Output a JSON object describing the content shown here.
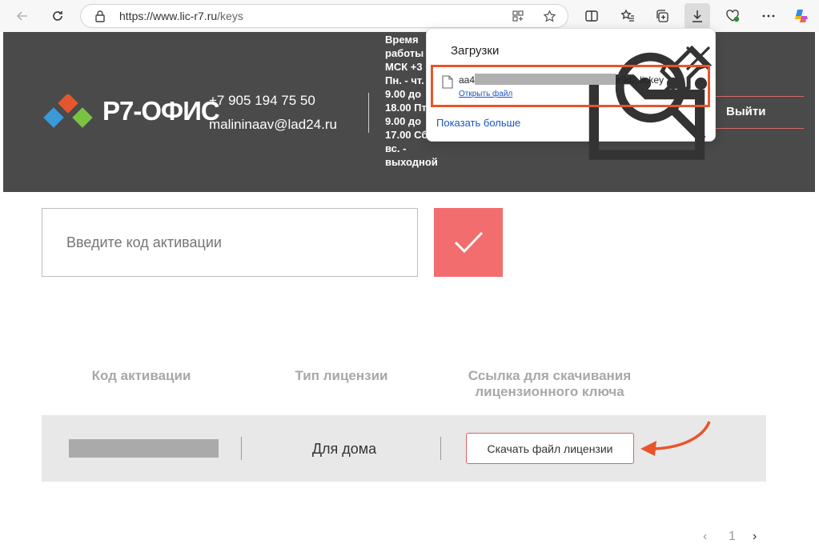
{
  "browser": {
    "url_domain": "https://www.lic-r7.ru",
    "url_path": "/keys"
  },
  "header": {
    "logo_text": "Р7-ОФИС",
    "phone": "+7 905 194 75 50",
    "email": "malininaav@lad24.ru",
    "hours_title": "Время работы по МСК +3",
    "hours_lines": "Пн. - чт. с 9.00 до 18.00 Пт. с 9.00 до 17.00 Сб., вс. - выходной",
    "logout": "Выйти"
  },
  "activation": {
    "placeholder": "Введите код активации"
  },
  "table": {
    "headers": [
      "Код активации",
      "Тип лицензии",
      "Ссылка для скачивания лицензионного ключа"
    ],
    "rows": [
      {
        "code": "",
        "type": "Для дома",
        "download_label": "Скачать файл лицензии"
      }
    ]
  },
  "pagination": {
    "page": "1"
  },
  "downloads_panel": {
    "title": "Загрузки",
    "file_prefix": "aa4",
    "file_suffix": "a9d2.lickey",
    "open_file": "Открыть файл",
    "show_more": "Показать больше"
  },
  "colors": {
    "accent": "#f26d6d",
    "header_bg": "#4a4a4a",
    "highlight": "#e8552a",
    "link": "#1a55c0"
  }
}
